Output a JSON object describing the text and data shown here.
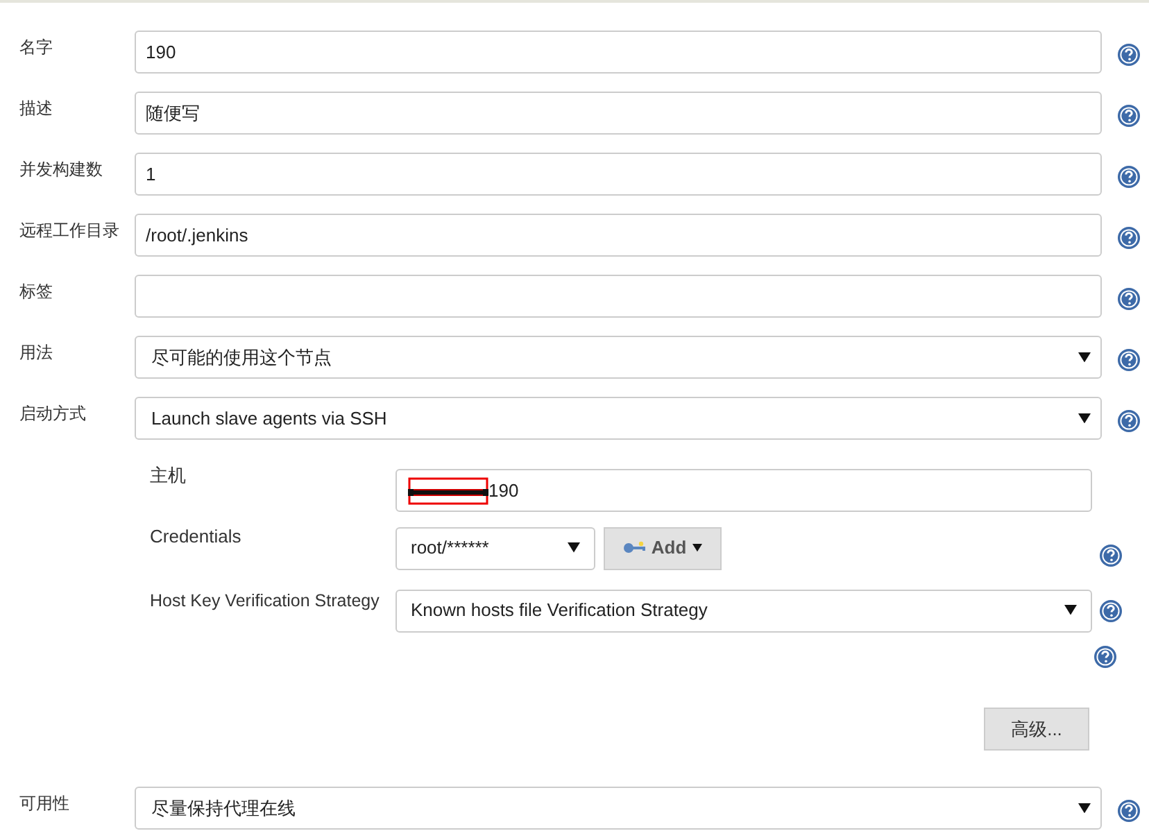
{
  "fields": [
    {
      "label": "名字",
      "kind": "text",
      "value": "190"
    },
    {
      "label": "描述",
      "kind": "text",
      "value": "随便写"
    },
    {
      "label": "并发构建数",
      "kind": "text",
      "value": "1"
    },
    {
      "label": "远程工作目录",
      "kind": "text",
      "value": "/root/.jenkins"
    },
    {
      "label": "标签",
      "kind": "text"
    },
    {
      "label": "用法",
      "kind": "select",
      "value": "尽可能的使用这个节点"
    },
    {
      "label": "启动方式",
      "kind": "select",
      "value": "Launch slave agents via SSH"
    }
  ],
  "launcher": {
    "host": {
      "label": "主机",
      "value": "190",
      "redacted": true
    },
    "credentials": {
      "label": "Credentials",
      "value": "root/******",
      "add_button": "Add"
    },
    "host_key": {
      "label": "Host Key Verification Strategy",
      "value": "Known hosts file Verification Strategy"
    },
    "advanced_button": "高级..."
  },
  "availability": {
    "label": "可用性",
    "kind": "select",
    "value": "尽量保持代理在线"
  }
}
